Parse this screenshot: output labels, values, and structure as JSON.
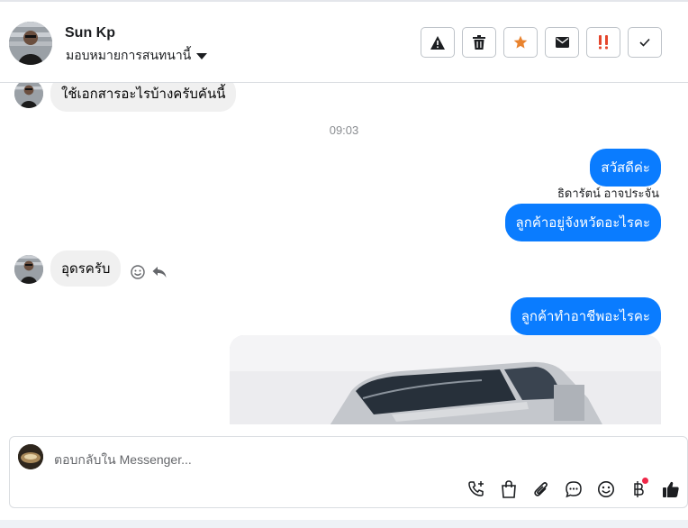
{
  "header": {
    "contact_name": "Sun Kp",
    "assign_label": "มอบหมายการสนทนานี้",
    "actions": [
      {
        "icon": "warning-icon"
      },
      {
        "icon": "trash-icon"
      },
      {
        "icon": "star-icon",
        "color": "#e9832e"
      },
      {
        "icon": "mail-icon"
      },
      {
        "icon": "urgent-icon",
        "color": "#e4462c"
      },
      {
        "icon": "check-icon"
      }
    ]
  },
  "messages": {
    "msg1": "ใช้เอกสารอะไรบ้างครับคันนี้",
    "time": "09:03",
    "out1": "สวัสดีค่ะ",
    "sender": "ธิดารัตน์ อาจประจัน",
    "out2": "ลูกค้าอยู่จังหวัดอะไรคะ",
    "in2": "อุดรครับ",
    "out3": "ลูกค้าทำอาชีพอะไรคะ"
  },
  "composer": {
    "placeholder": "ตอบกลับใน Messenger...",
    "tools": [
      "call-add-icon",
      "shopping-bag-icon",
      "paperclip-icon",
      "chat-bubble-icon",
      "emoji-icon",
      "baht-icon",
      "thumbs-up-icon"
    ]
  },
  "colors": {
    "outgoing_bubble": "#0a7cff",
    "incoming_bubble": "#f0f0f0",
    "notification_dot": "#f02849"
  }
}
